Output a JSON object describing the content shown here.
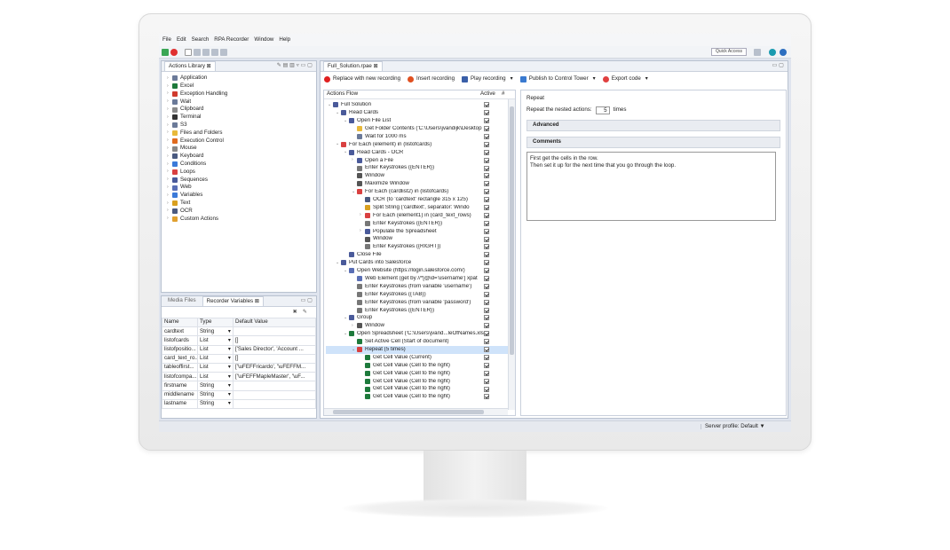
{
  "menu": [
    "File",
    "Edit",
    "Search",
    "RPA Recorder",
    "Window",
    "Help"
  ],
  "quick_access": "Quick Access",
  "actions_library": {
    "tab": "Actions Library",
    "items": [
      {
        "label": "Application",
        "color": "#6b7a99"
      },
      {
        "label": "Excel",
        "color": "#1e7a3c"
      },
      {
        "label": "Exception Handling",
        "color": "#d03b2e"
      },
      {
        "label": "Wait",
        "color": "#6b7a99"
      },
      {
        "label": "Clipboard",
        "color": "#8a8a8a"
      },
      {
        "label": "Terminal",
        "color": "#333333"
      },
      {
        "label": "S3",
        "color": "#6b7a99"
      },
      {
        "label": "Files and Folders",
        "color": "#e8b93a"
      },
      {
        "label": "Execution Control",
        "color": "#e06b1f"
      },
      {
        "label": "Mouse",
        "color": "#888888"
      },
      {
        "label": "Keyboard",
        "color": "#4a5a80"
      },
      {
        "label": "Conditions",
        "color": "#3b7ad9"
      },
      {
        "label": "Loops",
        "color": "#d94040"
      },
      {
        "label": "Sequences",
        "color": "#4a5a9a"
      },
      {
        "label": "Web",
        "color": "#5a6fb5"
      },
      {
        "label": "Variables",
        "color": "#3b7ad9"
      },
      {
        "label": "Text",
        "color": "#d9a020"
      },
      {
        "label": "OCR",
        "color": "#4a5a80"
      },
      {
        "label": "Custom Actions",
        "color": "#e0a030"
      }
    ]
  },
  "variables": {
    "tab_inactive": "Media Files",
    "tab_active": "Recorder Variables",
    "headers": [
      "Name",
      "Type",
      "Default Value"
    ],
    "rows": [
      [
        "cardtext",
        "String",
        ""
      ],
      [
        "listofcards",
        "List",
        "[]"
      ],
      [
        "listofpositio...",
        "List",
        "['Sales Director', 'Account ..."
      ],
      [
        "card_text_ro...",
        "List",
        "[]"
      ],
      [
        "tableoffirst...",
        "List",
        "['\\uFEFFricardo', '\\uFEFFM..."
      ],
      [
        "listofcompa...",
        "List",
        "['\\uFEFFMapleMaster', '\\uF..."
      ],
      [
        "firstname",
        "String",
        ""
      ],
      [
        "middlename",
        "String",
        ""
      ],
      [
        "lastname",
        "String",
        ""
      ]
    ]
  },
  "editor": {
    "tab": "Full_Solution.rpae",
    "toolbar": [
      "Replace with new recording",
      "Insert recording",
      "Play recording",
      "Publish to Control Tower",
      "Export code"
    ],
    "flow_header": "Actions Flow",
    "active_header": "Active",
    "hash_header": "#",
    "flow": [
      {
        "d": 0,
        "a": "v",
        "label": "Full Solution",
        "c": "#4a5a9a"
      },
      {
        "d": 1,
        "a": "v",
        "label": "Read Cards",
        "c": "#4a5a9a"
      },
      {
        "d": 2,
        "a": "v",
        "label": "Open File List",
        "c": "#4a5a9a"
      },
      {
        "d": 3,
        "a": "",
        "label": "Get Folder Contents ('C:\\Users\\jvandijk\\Desktop",
        "c": "#e8b93a"
      },
      {
        "d": 3,
        "a": "",
        "label": "Wait for 1000 ms",
        "c": "#6b7a99"
      },
      {
        "d": 1,
        "a": "v",
        "label": "For Each (element) in (listofcards)",
        "c": "#d94040"
      },
      {
        "d": 2,
        "a": "v",
        "label": "Read Cards - OCR",
        "c": "#4a5a9a"
      },
      {
        "d": 3,
        "a": ">",
        "label": "Open a File",
        "c": "#4a5a9a"
      },
      {
        "d": 3,
        "a": "",
        "label": "Enter Keystrokes ({ENTER})",
        "c": "#777777"
      },
      {
        "d": 3,
        "a": "",
        "label": "Window",
        "c": "#555555"
      },
      {
        "d": 3,
        "a": "",
        "label": "Maximize Window",
        "c": "#555555"
      },
      {
        "d": 3,
        "a": "v",
        "label": "For Each (cardlist2) in (listofcards)",
        "c": "#d94040"
      },
      {
        "d": 4,
        "a": "",
        "label": "OCR (to 'cardtext' rectangle 315 x 125)",
        "c": "#4a5a80"
      },
      {
        "d": 4,
        "a": "",
        "label": "Split String ('cardtext', separator: Windo",
        "c": "#d9a020"
      },
      {
        "d": 4,
        "a": ">",
        "label": "For Each (element1) in (card_text_rows)",
        "c": "#d94040"
      },
      {
        "d": 4,
        "a": "",
        "label": "Enter Keystrokes ({ENTER})",
        "c": "#777777"
      },
      {
        "d": 4,
        "a": ">",
        "label": "Populate the Spreadsheet",
        "c": "#4a5a9a"
      },
      {
        "d": 4,
        "a": "",
        "label": "Window",
        "c": "#555555"
      },
      {
        "d": 4,
        "a": "",
        "label": "Enter Keystrokes ({RIGHT})",
        "c": "#777777"
      },
      {
        "d": 2,
        "a": "",
        "label": "Close File",
        "c": "#4a5a9a"
      },
      {
        "d": 1,
        "a": "v",
        "label": "Put Cards into Salesforce",
        "c": "#4a5a9a"
      },
      {
        "d": 2,
        "a": "v",
        "label": "Open Website (https://login.salesforce.com/)",
        "c": "#5a6fb5"
      },
      {
        "d": 3,
        "a": "",
        "label": "Web Element (get by //*[@id='username'] xpat",
        "c": "#5a6fb5"
      },
      {
        "d": 3,
        "a": "",
        "label": "Enter Keystrokes (from variable 'username')",
        "c": "#777777"
      },
      {
        "d": 3,
        "a": "",
        "label": "Enter Keystrokes ({TAB})",
        "c": "#777777"
      },
      {
        "d": 3,
        "a": "",
        "label": "Enter Keystrokes (from variable 'password')",
        "c": "#777777"
      },
      {
        "d": 3,
        "a": "",
        "label": "Enter Keystrokes ({ENTER})",
        "c": "#777777"
      },
      {
        "d": 2,
        "a": "v",
        "label": "Group",
        "c": "#4a5a9a"
      },
      {
        "d": 3,
        "a": ">",
        "label": "Window",
        "c": "#555555"
      },
      {
        "d": 2,
        "a": "v",
        "label": "Open Spreadsheet ('C:\\Users\\jvand...leOfNames.xls",
        "c": "#1e7a3c"
      },
      {
        "d": 3,
        "a": "",
        "label": "Set Active Cell (Start of document)",
        "c": "#1e7a3c"
      },
      {
        "d": 3,
        "a": "v",
        "label": "Repeat (5 times)",
        "c": "#d94040",
        "sel": true
      },
      {
        "d": 4,
        "a": "",
        "label": "Get Cell Value (Current)",
        "c": "#1e7a3c"
      },
      {
        "d": 4,
        "a": "",
        "label": "Get Cell Value (Cell to the right)",
        "c": "#1e7a3c"
      },
      {
        "d": 4,
        "a": "",
        "label": "Get Cell Value (Cell to the right)",
        "c": "#1e7a3c"
      },
      {
        "d": 4,
        "a": "",
        "label": "Get Cell Value (Cell to the right)",
        "c": "#1e7a3c"
      },
      {
        "d": 4,
        "a": "",
        "label": "Get Cell Value (Cell to the right)",
        "c": "#1e7a3c"
      },
      {
        "d": 4,
        "a": "",
        "label": "Get Cell Value (Cell to the right)",
        "c": "#1e7a3c"
      }
    ]
  },
  "properties": {
    "title": "Repeat",
    "repeat_label": "Repeat the nested actions:",
    "repeat_value": "5",
    "repeat_unit": "times",
    "advanced": "Advanced",
    "comments": "Comments",
    "comment_line1": "First get the cells in the row.",
    "comment_line2": "Then set it up for the next time that you go through the loop."
  },
  "status": {
    "server_profile": "Server profile: Default ▼"
  }
}
